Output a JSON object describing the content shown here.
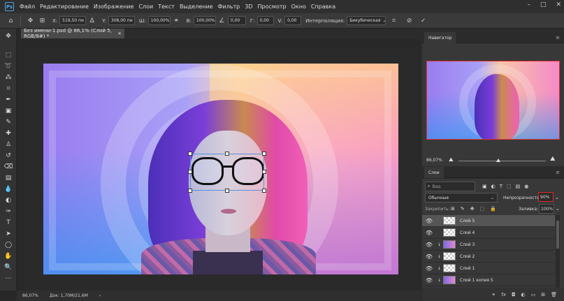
{
  "app": {
    "logo": "Ps"
  },
  "menu": [
    "Файл",
    "Редактирование",
    "Изображение",
    "Слои",
    "Текст",
    "Выделение",
    "Фильтр",
    "3D",
    "Просмотр",
    "Окно",
    "Справка"
  ],
  "window_controls": [
    "–",
    "□",
    "✕"
  ],
  "options": {
    "x_label": "X:",
    "x_value": "519,50 пи",
    "y_label": "Y:",
    "y_value": "308,00 пи",
    "w_label": "Ш:",
    "w_value": "100,00%",
    "h_label": "В:",
    "h_value": "100,00%",
    "angle_value": "0,00",
    "hskew_label": "Г:",
    "hskew_value": "0,00",
    "vskew_label": "V:",
    "vskew_value": "0,00",
    "interp_label": "Интерполяция:",
    "interp_value": "Бикубическая"
  },
  "document": {
    "tab_title": "Без имени-1.psd @ 86,1% (Слой 5, RGB/8#) *"
  },
  "status": {
    "zoom": "86,07%",
    "doc_info": "Док: 1,70M/21,6M"
  },
  "navigator": {
    "tab": "Навигатор",
    "zoom": "86,07%"
  },
  "layers_panel": {
    "tab": "Слои",
    "search_placeholder": "Вид",
    "blend_mode": "Обычные",
    "opacity_label": "Непрозрачность:",
    "opacity_value": "90%",
    "lock_label": "Закрепить:",
    "fill_label": "Заливка:",
    "fill_value": "100%",
    "layers": [
      {
        "name": "Слой 5",
        "selected": true,
        "clipped": false,
        "thumb": "transparent"
      },
      {
        "name": "Слой 4",
        "selected": false,
        "clipped": false,
        "thumb": "transparent"
      },
      {
        "name": "Слой 3",
        "selected": false,
        "clipped": true,
        "thumb": "image"
      },
      {
        "name": "Слой 2",
        "selected": false,
        "clipped": true,
        "thumb": "transparent"
      },
      {
        "name": "Слой 1",
        "selected": false,
        "clipped": true,
        "thumb": "transparent"
      },
      {
        "name": "Слой 1 копия 5",
        "selected": false,
        "clipped": true,
        "thumb": "image"
      }
    ]
  },
  "colors": {
    "accent": "#e0282c",
    "selection": "#5a8fd8",
    "foreground": "#1f8fe0",
    "background": "#111111"
  }
}
